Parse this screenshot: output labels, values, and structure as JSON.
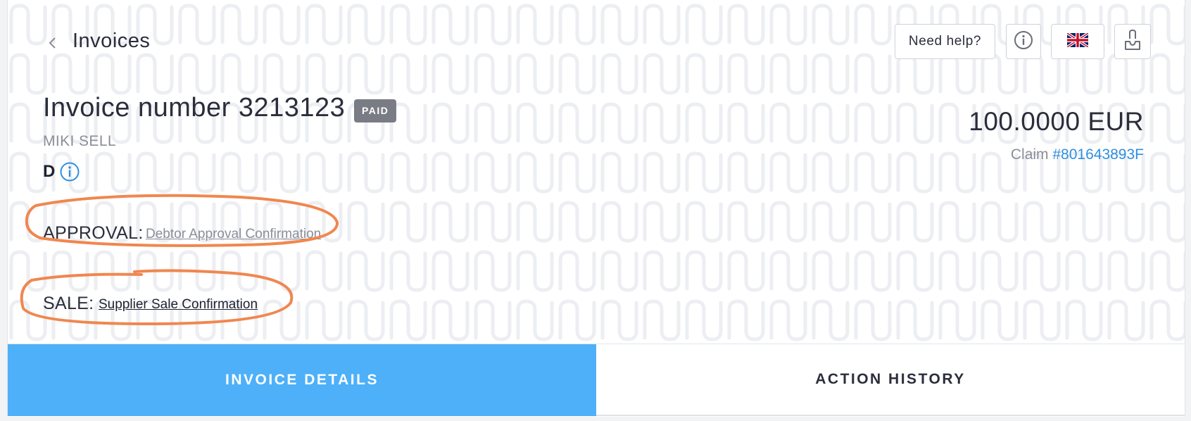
{
  "header": {
    "back_icon": "chevron-left-icon",
    "title": "Invoices",
    "help_label": "Need help?",
    "info_icon": "info-icon",
    "language_icon": "uk-flag-icon",
    "logout_icon": "logout-icon"
  },
  "invoice": {
    "title": "Invoice number 3213123",
    "status": "PAID",
    "debtor": "MIKI SELL",
    "grade": "D",
    "amount": "100.0000 EUR",
    "claim_prefix": "Claim",
    "claim_id": "#801643893F"
  },
  "approval": {
    "label": "APPROVAL:",
    "link": "Debtor Approval Confirmation"
  },
  "sale": {
    "label": "SALE:",
    "link": "Supplier Sale Confirmation"
  },
  "tabs": [
    {
      "label": "INVOICE DETAILS",
      "active": true
    },
    {
      "label": "ACTION HISTORY",
      "active": false
    }
  ],
  "colors": {
    "accent": "#4db0f9",
    "link": "#2f8fe0",
    "annotation": "#f0874f",
    "badge": "#7a7c85"
  }
}
